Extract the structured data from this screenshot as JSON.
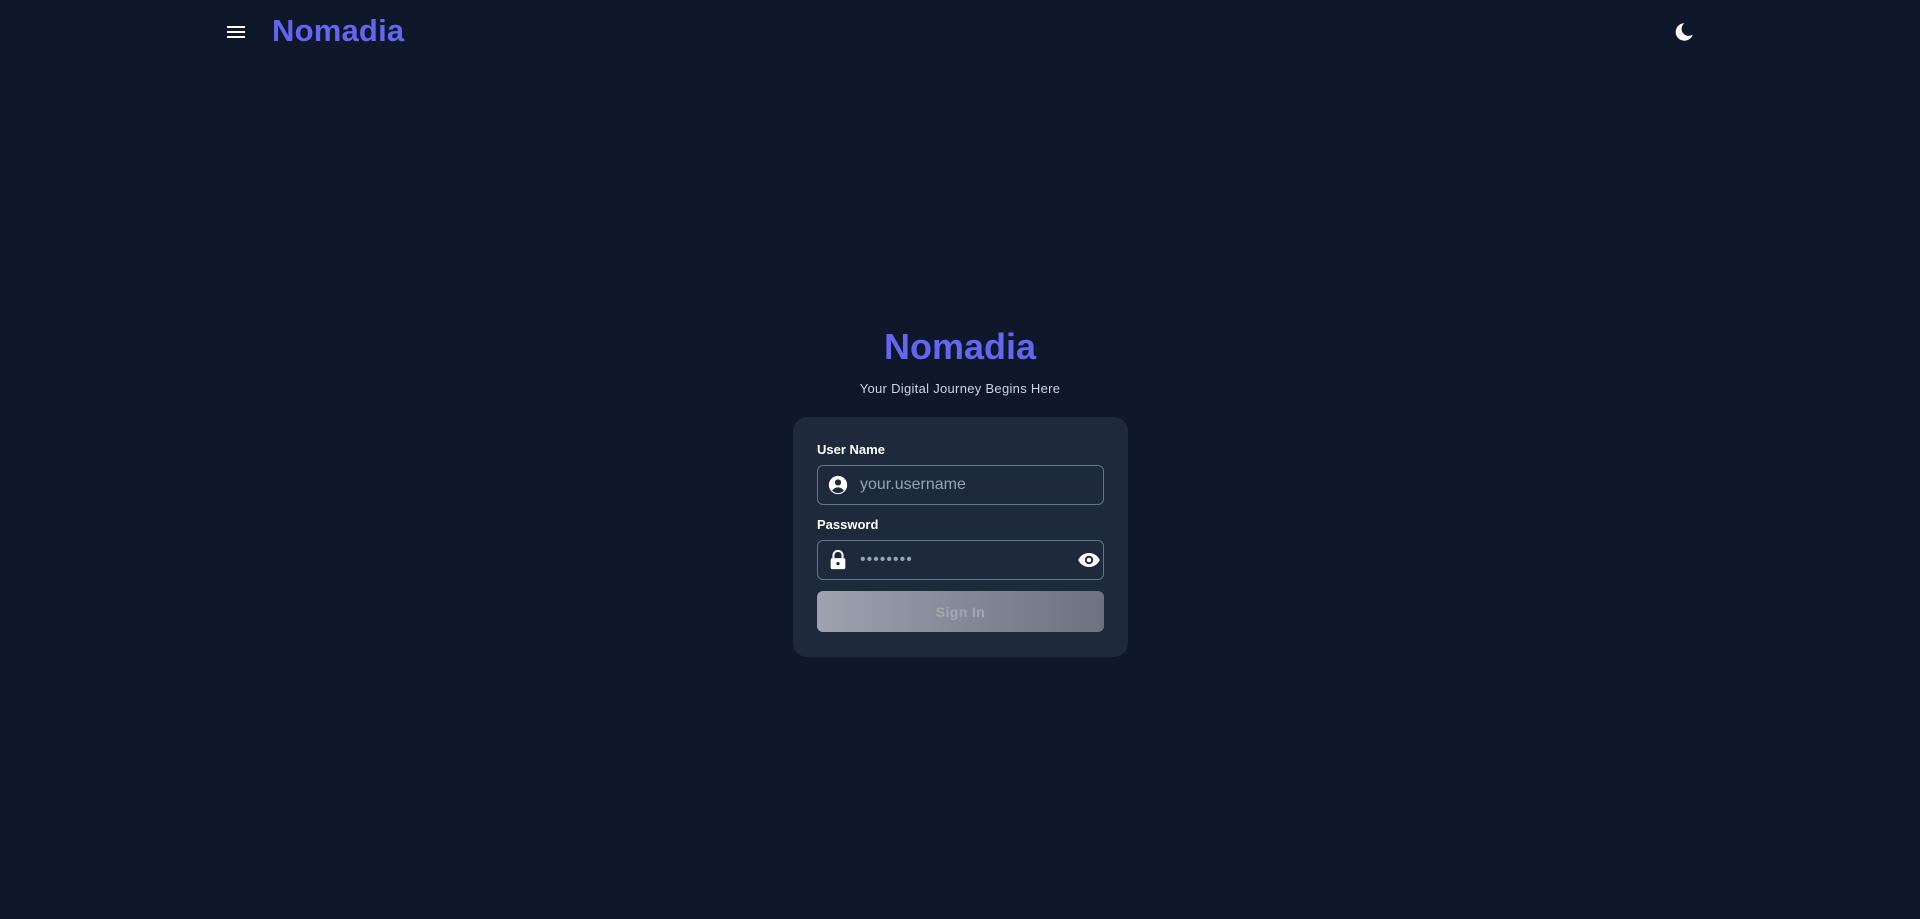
{
  "header": {
    "brand": "Nomadia",
    "menu_icon": "hamburger-menu-icon",
    "theme_icon": "moon-icon"
  },
  "hero": {
    "title": "Nomadia",
    "subtitle": "Your Digital Journey Begins Here"
  },
  "login_form": {
    "username_label": "User Name",
    "username_placeholder": "your.username",
    "username_value": "",
    "username_icon": "account-circle-icon",
    "password_label": "Password",
    "password_placeholder": "••••••••",
    "password_value": "",
    "password_icon": "lock-icon",
    "toggle_visibility_icon": "eye-icon",
    "submit_label": "Sign In"
  },
  "colors": {
    "background": "#0f172a",
    "card": "#1e293b",
    "accent": "#6366f1",
    "button_disabled_start": "#9ca3af",
    "button_disabled_end": "#6b7280"
  }
}
